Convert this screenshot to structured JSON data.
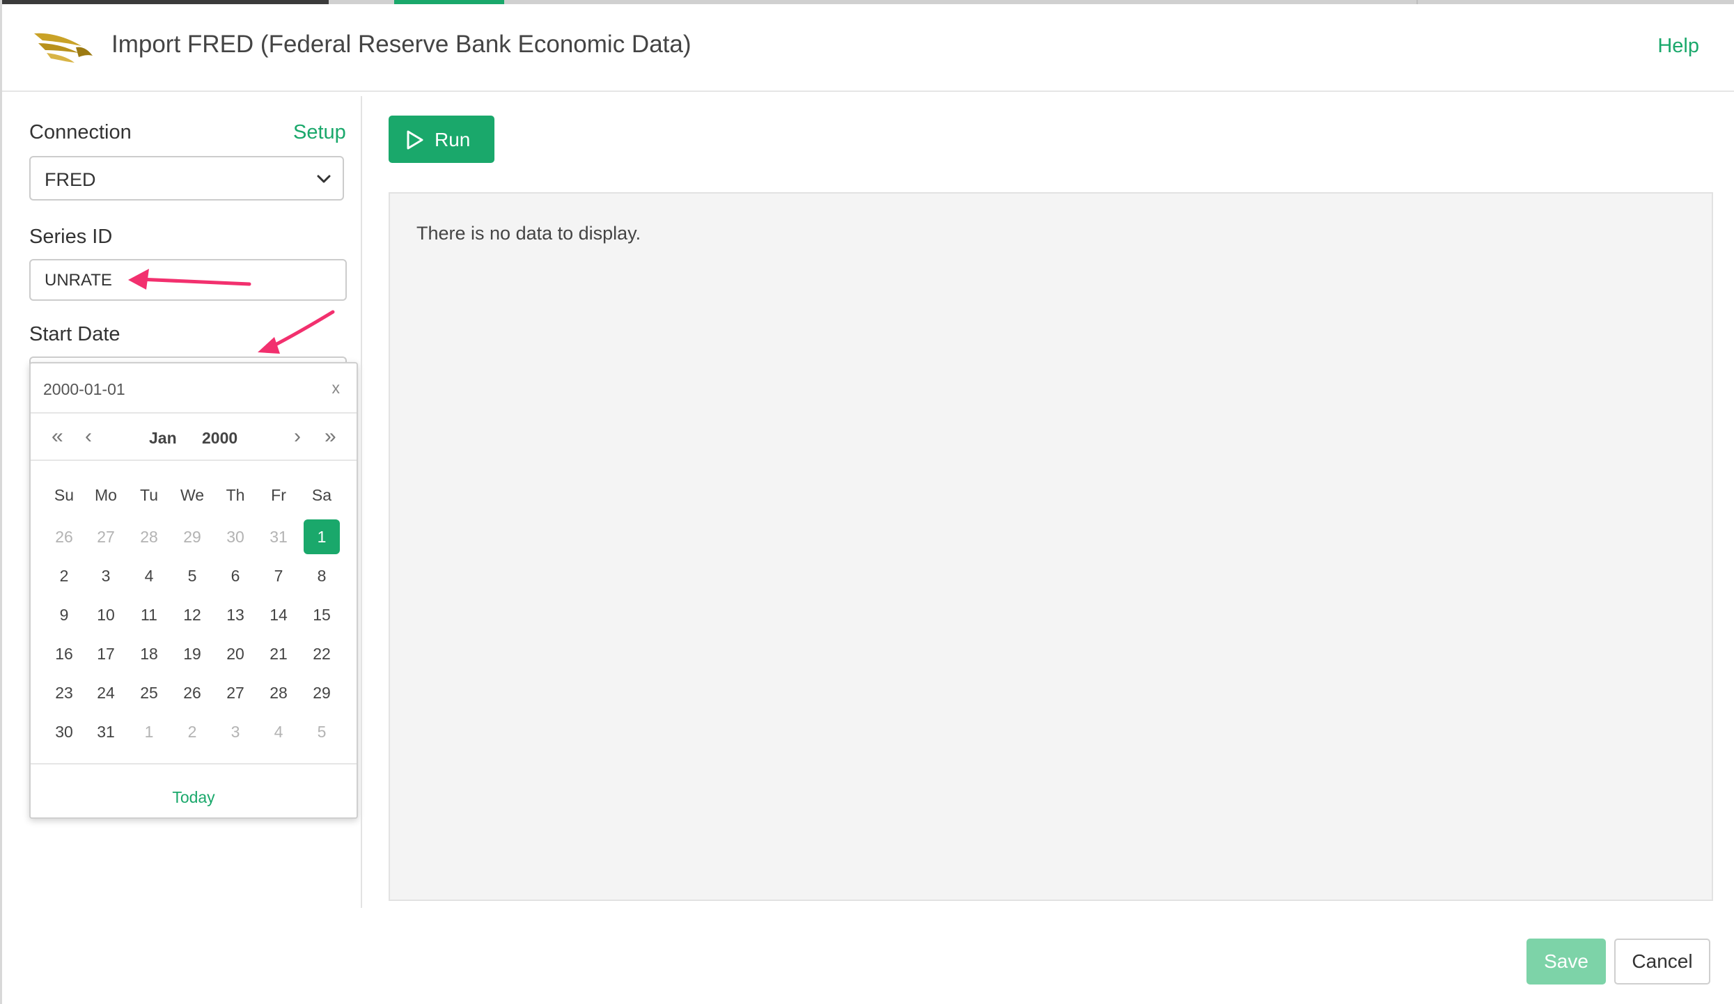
{
  "header": {
    "title": "Import FRED (Federal Reserve Bank Economic Data)",
    "help_label": "Help"
  },
  "sidebar": {
    "connection_label": "Connection",
    "setup_label": "Setup",
    "connection_value": "FRED",
    "series_id_label": "Series ID",
    "series_id_value": "UNRATE",
    "start_date_label": "Start Date"
  },
  "datepicker": {
    "input_value": "2000-01-01",
    "clear_label": "x",
    "nav": {
      "prev_year": "«",
      "prev_month": "‹",
      "next_month": "›",
      "next_year": "»"
    },
    "month": "Jan",
    "year": "2000",
    "weekdays": [
      "Su",
      "Mo",
      "Tu",
      "We",
      "Th",
      "Fr",
      "Sa"
    ],
    "weeks": [
      [
        "26",
        "27",
        "28",
        "29",
        "30",
        "31",
        "1"
      ],
      [
        "2",
        "3",
        "4",
        "5",
        "6",
        "7",
        "8"
      ],
      [
        "9",
        "10",
        "11",
        "12",
        "13",
        "14",
        "15"
      ],
      [
        "16",
        "17",
        "18",
        "19",
        "20",
        "21",
        "22"
      ],
      [
        "23",
        "24",
        "25",
        "26",
        "27",
        "28",
        "29"
      ],
      [
        "30",
        "31",
        "1",
        "2",
        "3",
        "4",
        "5"
      ]
    ],
    "selected_day": "1",
    "today_label": "Today"
  },
  "main": {
    "run_label": "Run",
    "empty_message": "There is no data to display."
  },
  "footer": {
    "save_label": "Save",
    "cancel_label": "Cancel"
  },
  "colors": {
    "accent": "#1aa86b",
    "accent_light": "#7dd3a8",
    "annotation_arrow": "#f2306e",
    "logo_gold": "#c9a227"
  },
  "icons": {
    "logo": "eagle-logo-icon",
    "dropdown": "chevron-down-icon",
    "run": "play-icon"
  }
}
